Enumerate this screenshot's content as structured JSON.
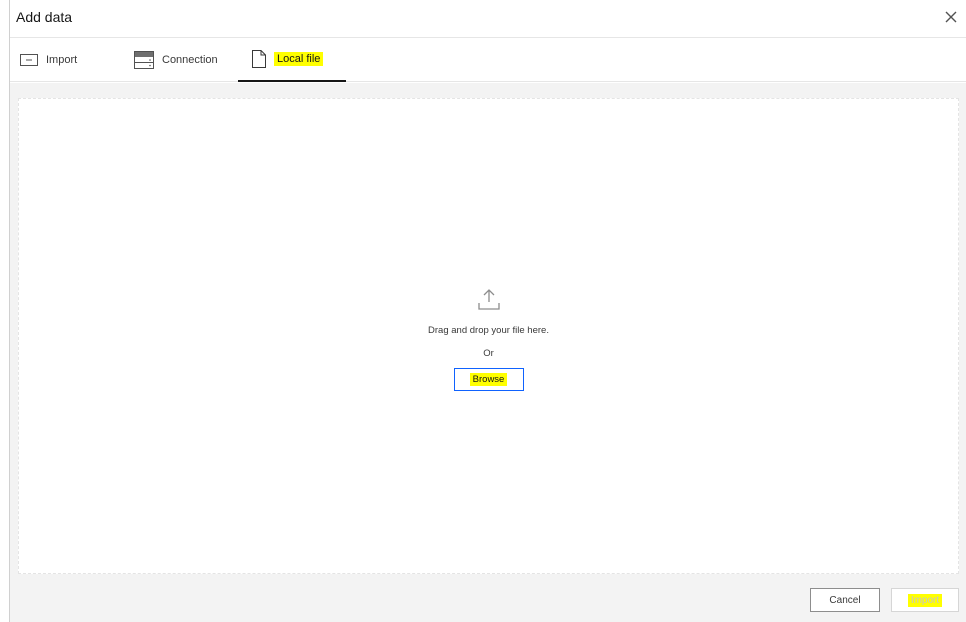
{
  "dialog": {
    "title": "Add data",
    "close_icon": "close-icon"
  },
  "tabs": [
    {
      "label": "Import",
      "icon": "import-icon"
    },
    {
      "label": "Connection",
      "icon": "database-icon"
    },
    {
      "label": "Local file",
      "icon": "file-icon",
      "selected": true
    }
  ],
  "dropzone": {
    "icon": "upload-icon",
    "instruction": "Drag and drop your file here.",
    "or_text": "Or",
    "browse_label": "Browse"
  },
  "footer": {
    "cancel_label": "Cancel",
    "import_label": "Import",
    "import_disabled": true
  },
  "colors": {
    "highlight": "#ffff00",
    "accent": "#0f62fe",
    "background": "#f3f3f3"
  }
}
